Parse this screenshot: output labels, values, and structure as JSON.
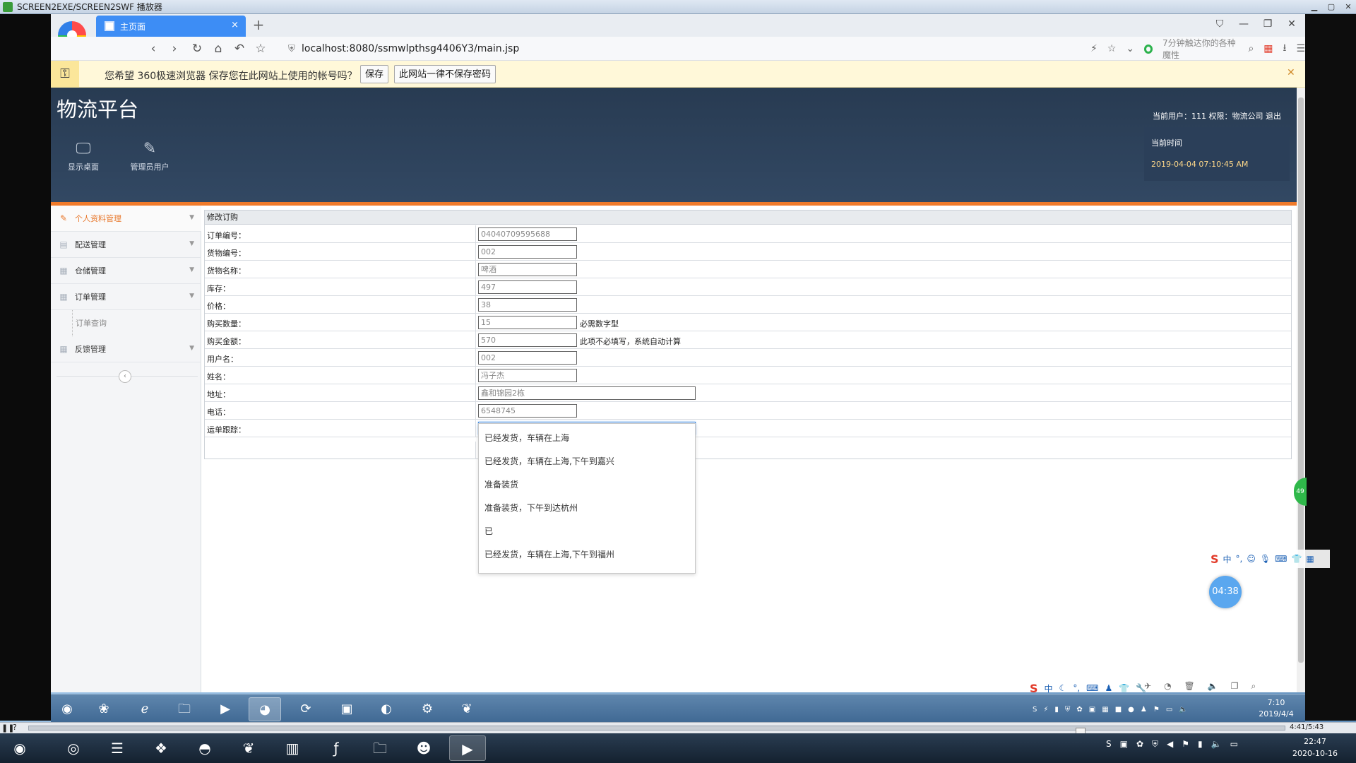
{
  "player": {
    "title": "SCREEN2EXE/SCREEN2SWF 播放器",
    "elapsed": "4:41/5:43",
    "progress_fraction": 0.84
  },
  "browser": {
    "tab_title": "主页面",
    "url": "localhost:8080/ssmwlpthsg4406Y3/main.jsp",
    "news_text": "7分钟触达你的各种魔性",
    "password_bar": {
      "question": "您希望 360极速浏览器 保存您在此网站上使用的帐号吗？",
      "save_label": "保存",
      "never_label": "此网站一律不保存密码"
    }
  },
  "app": {
    "title": "物流平台",
    "user_info": "当前用户：111  权限：物流公司  退出",
    "header_buttons": [
      {
        "label": "显示桌面",
        "icon": "monitor-icon"
      },
      {
        "label": "管理员用户",
        "icon": "pencil-icon"
      }
    ],
    "time_label": "当前时间",
    "time_value": "2019-04-04 07:10:45 AM"
  },
  "sidebar": {
    "items": [
      {
        "label": "个人资料管理",
        "icon": "pencil-icon",
        "active": true
      },
      {
        "label": "配送管理",
        "icon": "list-icon"
      },
      {
        "label": "仓储管理",
        "icon": "grid-icon"
      },
      {
        "label": "订单管理",
        "icon": "grid-icon"
      },
      {
        "label": "反馈管理",
        "icon": "grid-icon"
      }
    ],
    "sub_item": "订单查询"
  },
  "form": {
    "title": "修改订购",
    "rows": [
      {
        "label": "订单编号：",
        "value": "04040709595688"
      },
      {
        "label": "货物编号：",
        "value": "002"
      },
      {
        "label": "货物名称：",
        "value": "啤酒"
      },
      {
        "label": "库存：",
        "value": "497"
      },
      {
        "label": "价格：",
        "value": "38"
      },
      {
        "label": "购买数量：",
        "value": "15",
        "hint": "必需数字型"
      },
      {
        "label": "购买金额：",
        "value": "570",
        "hint": "此项不必填写，系统自动计算"
      },
      {
        "label": "用户名：",
        "value": "002"
      },
      {
        "label": "姓名：",
        "value": "冯子杰"
      },
      {
        "label": "地址：",
        "value": "鑫和锦园2栋"
      },
      {
        "label": "电话：",
        "value": "6548745"
      },
      {
        "label": "运单跟踪：",
        "value": ""
      }
    ]
  },
  "autocomplete": [
    "已经发货，车辆在上海",
    "已经发货，车辆在上海,下午到嘉兴",
    "准备装货",
    "准备装货，下午到达杭州",
    "已",
    "已经发货，车辆在上海,下午到福州"
  ],
  "overlays": {
    "timer": "04:38",
    "green_tab": "49"
  },
  "inner_taskbar": {
    "clock_time": "7:10",
    "clock_date": "2019/4/4"
  },
  "outer_taskbar": {
    "clock_time": "22:47",
    "clock_date": "2020-10-16"
  },
  "ime": {
    "label": "中"
  }
}
